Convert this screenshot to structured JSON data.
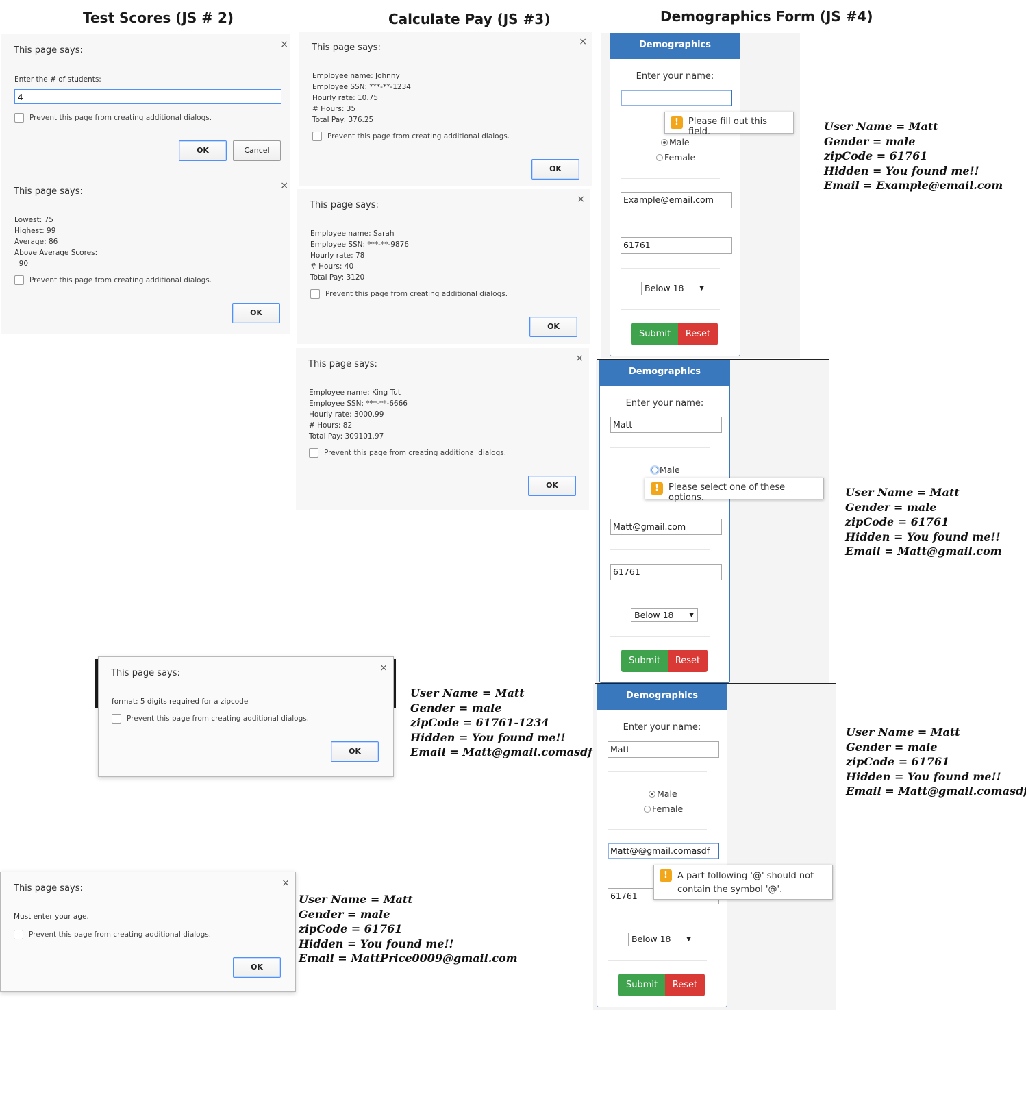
{
  "headings": {
    "test_scores": "Test Scores (JS # 2)",
    "calculate_pay": "Calculate Pay (JS #3)",
    "demographics_form": "Demographics Form (JS #4)"
  },
  "dialog_common": {
    "says": "This page says:",
    "prevent": "Prevent this page from creating additional dialogs.",
    "ok": "OK",
    "cancel": "Cancel",
    "close": "×"
  },
  "test_scores": {
    "prompt_label": "Enter the # of students:",
    "prompt_value": "4",
    "results": "Lowest: 75\nHighest: 99\nAverage: 86\nAbove Average Scores:\n  90"
  },
  "pay": [
    {
      "message": "Employee name: Johnny\nEmployee SSN: ***-**-1234\nHourly rate: 10.75\n# Hours: 35\nTotal Pay: 376.25"
    },
    {
      "message": "Employee name: Sarah\nEmployee SSN: ***-**-9876\nHourly rate: 78\n# Hours: 40\nTotal Pay: 3120"
    },
    {
      "message": "Employee name: King Tut\nEmployee SSN: ***-**-6666\nHourly rate: 3000.99\n# Hours: 82\nTotal Pay: 309101.97"
    }
  ],
  "zip_dialog": {
    "message": "format: 5 digits required for a zipcode"
  },
  "age_dialog": {
    "message": "Must enter your age."
  },
  "notes": {
    "n1": [
      "User Name = Matt",
      "Gender = male",
      "zipCode = 61761",
      "Hidden = You found me!!",
      "Email = Example@email.com"
    ],
    "n2": [
      "User Name = Matt",
      "Gender = male",
      "zipCode = 61761",
      "Hidden = You found me!!",
      "Email = Matt@gmail.com"
    ],
    "n3": [
      "User Name = Matt",
      "Gender = male",
      "zipCode = 61761",
      "Hidden = You found me!!",
      "Email = Matt@gmail.comasdf"
    ],
    "n4": [
      "User Name = Matt",
      "Gender = male",
      "zipCode = 61761-1234",
      "Hidden = You found me!!",
      "Email = Matt@gmail.comasdf"
    ],
    "n5": [
      "User Name = Matt",
      "Gender = male",
      "zipCode = 61761",
      "Hidden = You found me!!",
      "Email = MattPrice0009@gmail.com"
    ]
  },
  "demo_common": {
    "title": "Demographics",
    "name_label": "Enter your name:",
    "male": "Male",
    "female": "Female",
    "age_option": "Below 18",
    "submit": "Submit",
    "reset": "Reset"
  },
  "demo1": {
    "name_value": "",
    "email_value": "Example@email.com",
    "zip_value": "61761",
    "tooltip": "Please fill out this field."
  },
  "demo2": {
    "name_value": "Matt",
    "email_value": "Matt@gmail.com",
    "zip_value": "61761",
    "tooltip": "Please select one of these options."
  },
  "demo3": {
    "name_value": "Matt",
    "email_value": "Matt@@gmail.comasdf",
    "zip_value": "61761",
    "tooltip_line1": "A part following '@' should not",
    "tooltip_line2": "contain the symbol '@'."
  }
}
